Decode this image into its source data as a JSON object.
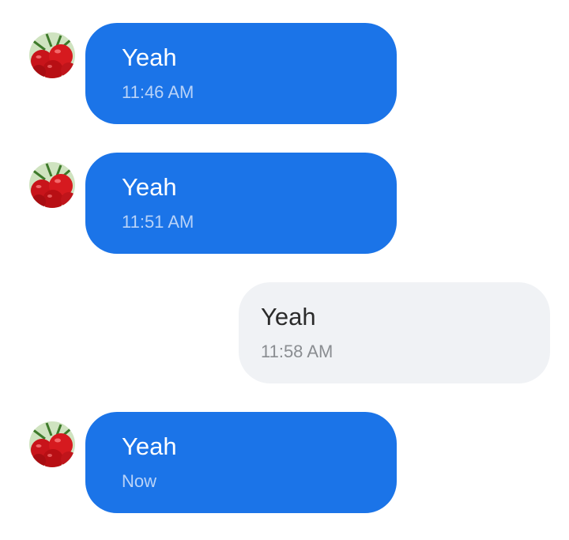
{
  "messages": [
    {
      "direction": "incoming",
      "text": "Yeah",
      "time": "11:46 AM",
      "avatar_icon": "tomato-avatar-icon"
    },
    {
      "direction": "incoming",
      "text": "Yeah",
      "time": "11:51 AM",
      "avatar_icon": "tomato-avatar-icon"
    },
    {
      "direction": "outgoing",
      "text": "Yeah",
      "time": "11:58 AM"
    },
    {
      "direction": "incoming",
      "text": "Yeah",
      "time": "Now",
      "avatar_icon": "tomato-avatar-icon"
    }
  ],
  "colors": {
    "incoming_bubble": "#1b74e8",
    "incoming_text": "#ffffff",
    "incoming_time": "#b9d3f8",
    "outgoing_bubble": "#f0f2f5",
    "outgoing_text": "#2b2b2b",
    "outgoing_time": "#8a8d91"
  }
}
